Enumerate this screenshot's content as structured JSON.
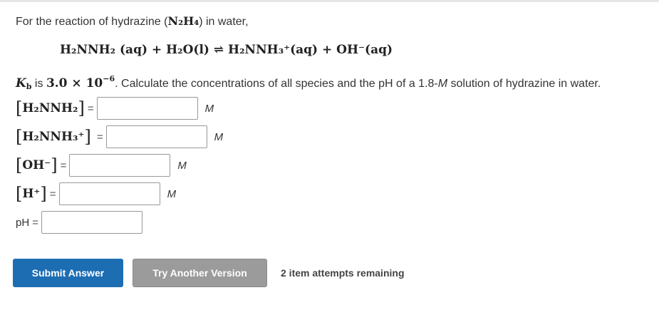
{
  "intro": {
    "prefix": "For the reaction of hydrazine (",
    "formula": "N₂H₄",
    "suffix": ") in water,"
  },
  "equation": {
    "lhs": "H₂NNH₂ (aq) + H₂O(l)",
    "arrow": "⇌",
    "rhs": "H₂NNH₃⁺(aq) + OH⁻(aq)"
  },
  "question": {
    "kb_symbol": "K",
    "kb_sub": "b",
    "is_text": " is ",
    "kb_value": "3.0 × 10",
    "kb_exp": "−6",
    "text_before_M": ". Calculate the concentrations of all species and the pH of a 1.8-",
    "molarity_unit": "M",
    "text_after_M": "  solution of hydrazine in water."
  },
  "fields": [
    {
      "label_inner": "H₂NNH₂",
      "value": "",
      "unit": "M"
    },
    {
      "label_inner": "H₂NNH₃⁺",
      "value": "",
      "unit": "M"
    },
    {
      "label_inner": "OH⁻",
      "value": "",
      "unit": "M"
    },
    {
      "label_inner": "H⁺",
      "value": "",
      "unit": "M"
    },
    {
      "label": "pH",
      "value": "",
      "unit": ""
    }
  ],
  "equals": "=",
  "buttons": {
    "submit": "Submit Answer",
    "try_another": "Try Another Version"
  },
  "attempts_text": "2 item attempts remaining",
  "colors": {
    "submit_bg": "#1d6db3",
    "try_bg": "#9b9b9b"
  }
}
